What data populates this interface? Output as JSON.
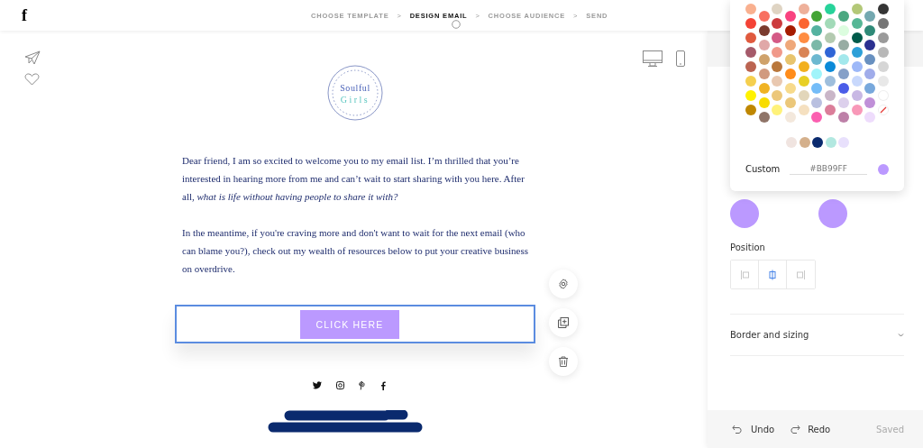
{
  "logo": {
    "text": "f"
  },
  "steps": [
    {
      "label": "CHOOSE TEMPLATE",
      "selected": false
    },
    {
      "label": "DESIGN EMAIL",
      "selected": true
    },
    {
      "label": "CHOOSE AUDIENCE",
      "selected": false
    },
    {
      "label": "SEND",
      "selected": false
    }
  ],
  "step_separators": [
    ">",
    ">",
    ">"
  ],
  "email": {
    "logo_lines": [
      "Soulful",
      "Girls"
    ],
    "paragraphs": [
      "Dear friend, I am so excited to welcome you to my email list. I’m thrilled that you’re interested in hearing more from me and can’t wait to start sharing with you here. After all, *what is life without having people to share it with?*",
      "In the meantime, if you're craving more and don't want to wait for the next email (who can blame you?), check out my wealth of resources below to put your creative business on overdrive."
    ],
    "button": {
      "label": "CLICK HERE",
      "color": "#bb99ff",
      "selected": true
    }
  },
  "palette": {
    "columns": [
      {
        "swatches": [
          {
            "color": "#f9b08f"
          },
          {
            "color": "#f44336"
          },
          {
            "color": "#e05a3e"
          },
          {
            "color": "#a55a6a"
          },
          {
            "color": "#bb6451"
          },
          {
            "color": "#f5cf4e"
          },
          {
            "color": "#fff200"
          },
          {
            "color": "#bf8700"
          }
        ]
      },
      {
        "swatches": [
          {
            "color": "#f87060"
          },
          {
            "color": "#7a3b2e"
          },
          {
            "color": "#e0a8a8"
          },
          {
            "color": "#cfa26b"
          },
          {
            "color": "#d19a7f"
          },
          {
            "color": "#f0b323"
          },
          {
            "color": "#f8dc00"
          },
          {
            "color": "#8f7468"
          }
        ]
      },
      {
        "swatches": [
          {
            "color": "#dfd4c3"
          },
          {
            "color": "#cc3b3e"
          },
          {
            "color": "#d45a86"
          },
          {
            "color": "#f0998a"
          },
          {
            "color": "#b9773c"
          },
          {
            "color": "#e9c8b0"
          },
          {
            "color": "#ecc77a"
          },
          {
            "color": "#fff27a"
          }
        ]
      },
      {
        "swatches": [
          {
            "color": "#f94380"
          },
          {
            "color": "#a61c00"
          },
          {
            "color": "#efa87a"
          },
          {
            "color": "#e8c46d"
          },
          {
            "color": "#ff8c1a"
          },
          {
            "color": "#f7da8b"
          },
          {
            "color": "#ebc77a"
          },
          {
            "color": "#f3e8dc"
          }
        ]
      },
      {
        "swatches": [
          {
            "color": "#eeb09a"
          },
          {
            "color": "#fb6430"
          },
          {
            "color": "#ff8c42"
          },
          {
            "color": "#d98455"
          },
          {
            "color": "#f2b01e"
          },
          {
            "color": "#e8cf25"
          },
          {
            "color": "#e2d6ba"
          },
          {
            "color": "#f5e0c0"
          }
        ]
      },
      {
        "swatches": [
          {
            "color": "#43a435"
          },
          {
            "color": "#55b2a0"
          },
          {
            "color": "#7bb8a8"
          },
          {
            "color": "#6db8d0"
          },
          {
            "color": "#a0f4fa"
          },
          {
            "color": "#74bcf8"
          },
          {
            "color": "#b9c0e0"
          },
          {
            "color": "#fb5fb0"
          }
        ]
      },
      {
        "swatches": [
          {
            "color": "#27d39a"
          },
          {
            "color": "#a2dab8"
          },
          {
            "color": "#b3cab0"
          },
          {
            "color": "#2f65d6"
          },
          {
            "color": "#0b8ad8"
          },
          {
            "color": "#9ebedc"
          },
          {
            "color": "#c9b6c8"
          },
          {
            "color": "#db7e9a"
          }
        ]
      },
      {
        "swatches": [
          {
            "color": "#4aa880"
          },
          {
            "color": "#dcfddf"
          },
          {
            "color": "#97aca3"
          },
          {
            "color": "#a3e8ec"
          },
          {
            "color": "#85a0c8"
          },
          {
            "color": "#4a5ce8"
          },
          {
            "color": "#dcd0ec"
          },
          {
            "color": "#bd80a8"
          }
        ]
      },
      {
        "swatches": [
          {
            "color": "#b3c878"
          },
          {
            "color": "#56b796"
          },
          {
            "color": "#005a4a"
          },
          {
            "color": "#2da0d8"
          },
          {
            "color": "#9db8f8"
          },
          {
            "color": "#c8d8fc"
          },
          {
            "color": "#c8b8e4"
          },
          {
            "color": "#f898b8"
          }
        ]
      },
      {
        "swatches": [
          {
            "color": "#74a8b0"
          },
          {
            "color": "#2f8a78"
          },
          {
            "color": "#2b3090"
          },
          {
            "color": "#6890c0"
          },
          {
            "color": "#a0acea"
          },
          {
            "color": "#78a8dc"
          },
          {
            "color": "#c090d8"
          },
          {
            "color": "#eedcfc"
          }
        ]
      },
      {
        "swatches": [
          {
            "color": "#353535"
          },
          {
            "color": "#767676"
          },
          {
            "color": "#9a9a9a"
          },
          {
            "color": "#b8b8b8"
          },
          {
            "color": "#d6d6d6"
          },
          {
            "color": "#e8e8e8"
          },
          {
            "color": "#ffffff"
          },
          {
            "kind": "none"
          }
        ]
      }
    ],
    "recent": [
      {
        "color": "#f0e4e0"
      },
      {
        "color": "#d4b08c"
      },
      {
        "color": "#0a2a6e"
      },
      {
        "color": "#b2e8e0"
      },
      {
        "color": "#e8e0fc"
      }
    ],
    "custom_label": "Custom",
    "custom_value": "#BB99FF"
  },
  "color_choices": [
    {
      "color": "#bb99ff"
    },
    {
      "color": "#bb99ff"
    }
  ],
  "position": {
    "label": "Position",
    "options": [
      {
        "kind": "left",
        "selected": false
      },
      {
        "kind": "center",
        "selected": true
      },
      {
        "kind": "right",
        "selected": false
      }
    ]
  },
  "sections": [
    {
      "label": "Border and sizing",
      "expanded": false
    }
  ],
  "footer": {
    "undo": "Undo",
    "redo": "Redo",
    "status": "Saved"
  }
}
